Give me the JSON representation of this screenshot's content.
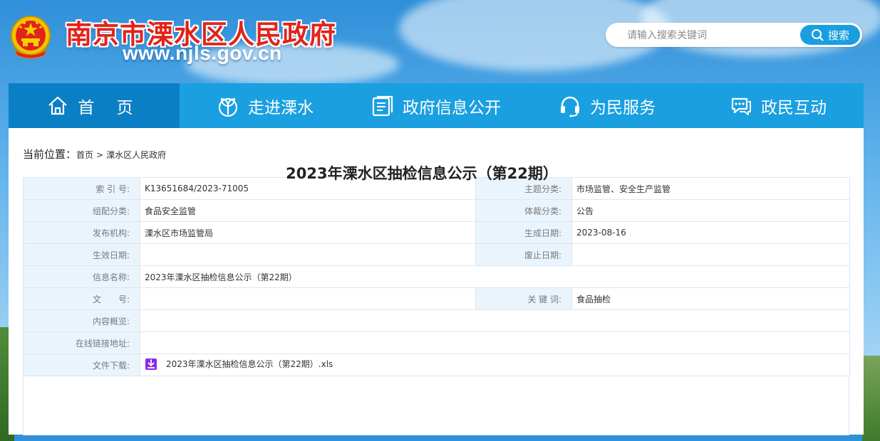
{
  "header": {
    "site_title": "南京市溧水区人民政府",
    "site_url": "www.njls.gov.cn",
    "emblem_icon": "national-emblem-icon",
    "search": {
      "placeholder": "请输入搜索关键词",
      "button_label": "搜索",
      "icon": "search-icon"
    }
  },
  "nav": {
    "items": [
      {
        "label": "首 页",
        "icon": "home-icon"
      },
      {
        "label": "走进溧水",
        "icon": "sprout-icon"
      },
      {
        "label": "政府信息公开",
        "icon": "document-icon"
      },
      {
        "label": "为民服务",
        "icon": "headset-icon"
      },
      {
        "label": "政民互动",
        "icon": "chat-icon"
      }
    ],
    "active_color": "#0b7fc5",
    "bar_color": "#1a9fe0"
  },
  "breadcrumb": {
    "label": "当前位置：",
    "items": [
      "首页",
      "溧水区人民政府"
    ],
    "separator": ">"
  },
  "meta": {
    "index_no_label": "索 引 号:",
    "index_no": "K13651684/2023-71005",
    "topic_label": "主题分类:",
    "topic": "市场监管、安全生产监管",
    "category_label": "组配分类:",
    "category": "食品安全监管",
    "genre_label": "体裁分类:",
    "genre": "公告",
    "publisher_label": "发布机构:",
    "publisher": "溧水区市场监管局",
    "created_label": "生成日期:",
    "created": "2023-08-16",
    "effective_label": "生效日期:",
    "effective": "",
    "repeal_label": "废止日期:",
    "repeal": "",
    "title_label": "信息名称:",
    "title": "2023年溧水区抽检信息公示（第22期）",
    "docno_label": "文　　号:",
    "docno": "",
    "keywords_label": "关 键 词:",
    "keywords": "食品抽检",
    "summary_label": "内容概览:",
    "summary": "",
    "link_label": "在线链接地址:",
    "link": "",
    "download_label": "文件下载:",
    "download_file": "2023年溧水区抽检信息公示（第22期）.xls"
  },
  "article": {
    "title": "2023年溧水区抽检信息公示（第22期）"
  }
}
